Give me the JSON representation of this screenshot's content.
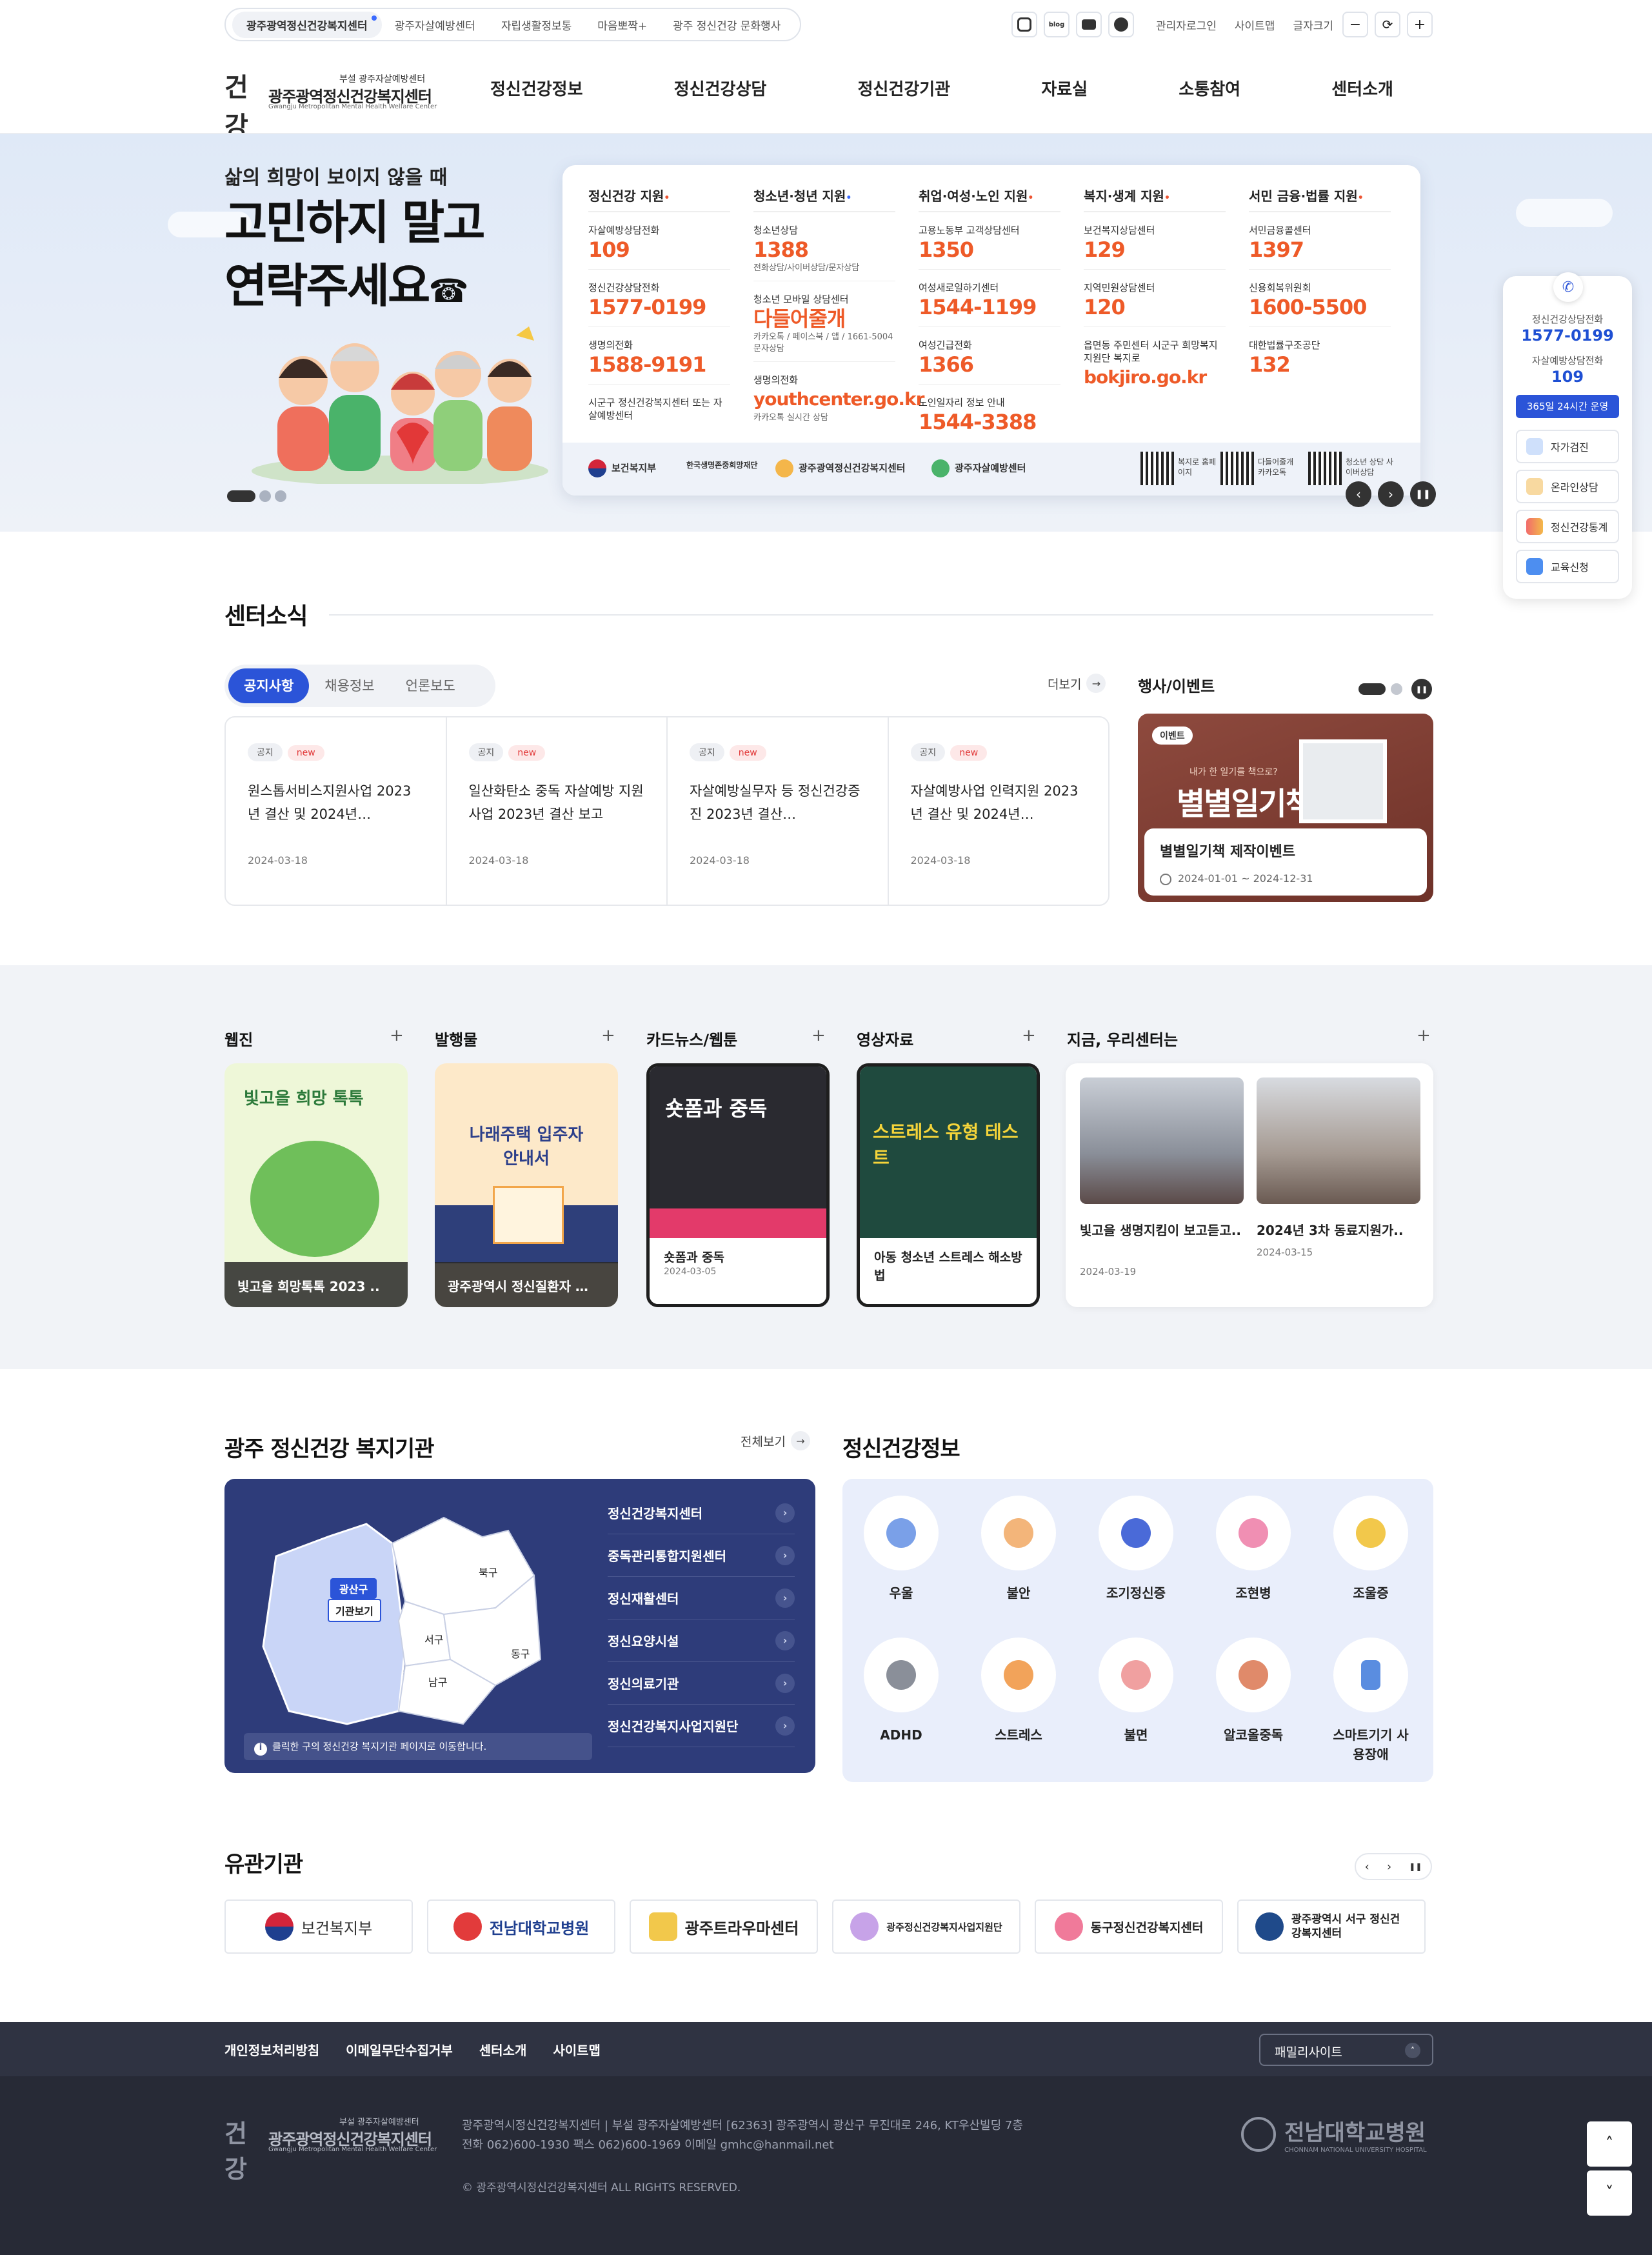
{
  "util": {
    "site_tabs": [
      "광주광역정신건강복지센터",
      "광주자살예방센터",
      "자립생활정보통",
      "마음뽀짝+",
      "광주 정신건강 문화행사"
    ],
    "sns": [
      "instagram-icon",
      "blog-icon",
      "youtube-icon",
      "talk-icon"
    ],
    "sns_blog": "blog",
    "links": [
      "관리자로그인",
      "사이트맵",
      "글자크기"
    ]
  },
  "logo": {
    "mark": "건강",
    "sub": "부설 광주자살예방센터",
    "main": "광주광역정신건강복지센터",
    "en": "Gwangju Metropolitan Mental Health Welfare Center"
  },
  "gnb": [
    "정신건강정보",
    "정신건강상담",
    "정신건강기관",
    "자료실",
    "소통참여",
    "센터소개"
  ],
  "hero": {
    "line1": "삶의 희망이 보이지 않을 때",
    "line2": "고민하지 말고",
    "line3": "연락주세요"
  },
  "hotline": {
    "cols": [
      {
        "title": "정신건강 지원",
        "items": [
          {
            "name": "자살예방상담전화",
            "num": "109",
            "note": ""
          },
          {
            "name": "정신건강상담전화",
            "num": "1577-0199",
            "note": ""
          },
          {
            "name": "생명의전화",
            "num": "1588-9191",
            "note": ""
          },
          {
            "name": "시군구 정신건강복지센터 또는 자살예방센터",
            "num": "",
            "note": ""
          }
        ]
      },
      {
        "title": "청소년·청년 지원",
        "items": [
          {
            "name": "청소년상담",
            "num": "1388",
            "note": "전화상담/사이버상담/문자상담"
          },
          {
            "name": "청소년 모바일 상담센터",
            "num": "다들어줄개",
            "note": "카카오톡 / 페이스북 / 앱 / 1661-5004 문자상담"
          },
          {
            "name": "생명의전화",
            "num": "youthcenter.go.kr",
            "note": "카카오톡 실시간 상담"
          }
        ]
      },
      {
        "title": "취업·여성·노인 지원",
        "items": [
          {
            "name": "고용노동부 고객상담센터",
            "num": "1350",
            "note": ""
          },
          {
            "name": "여성새로일하기센터",
            "num": "1544-1199",
            "note": ""
          },
          {
            "name": "여성긴급전화",
            "num": "1366",
            "note": ""
          },
          {
            "name": "노인일자리 정보 안내",
            "num": "1544-3388",
            "note": ""
          }
        ]
      },
      {
        "title": "복지·생계 지원",
        "items": [
          {
            "name": "보건복지상담센터",
            "num": "129",
            "note": ""
          },
          {
            "name": "지역민원상담센터",
            "num": "120",
            "note": ""
          },
          {
            "name": "읍면동 주민센터 시군구 희망복지지원단 복지로",
            "num": "bokjiro.go.kr",
            "note": ""
          }
        ]
      },
      {
        "title": "서민 금융·법률 지원",
        "items": [
          {
            "name": "서민금융콜센터",
            "num": "1397",
            "note": ""
          },
          {
            "name": "신용회복위원회",
            "num": "1600-5500",
            "note": ""
          },
          {
            "name": "대한법률구조공단",
            "num": "132",
            "note": ""
          }
        ]
      }
    ],
    "orgs": [
      "보건복지부",
      "한국생명존중희망재단",
      "광주광역정신건강복지센터",
      "광주자살예방센터"
    ],
    "qrs": [
      "복지로 홈페이지",
      "다들어줄개 카카오톡",
      "청소년 상담 사이버상담"
    ]
  },
  "quick": {
    "l1": "정신건강상담전화",
    "n1": "1577-0199",
    "l2": "자살예방상담전화",
    "n2": "109",
    "op": "365일 24시간 운영",
    "menu": [
      "자가검진",
      "온라인상담",
      "정신건강통계",
      "교육신청"
    ]
  },
  "news": {
    "title": "센터소식",
    "tabs": [
      "공지사항",
      "채용정보",
      "언론보도"
    ],
    "more": "더보기",
    "items": [
      {
        "tag": "공지",
        "new": "new",
        "title": "원스톱서비스지원사업 2023년 결산 및 2024년…",
        "date": "2024-03-18"
      },
      {
        "tag": "공지",
        "new": "new",
        "title": "일산화탄소 중독 자살예방 지원사업 2023년 결산 보고",
        "date": "2024-03-18"
      },
      {
        "tag": "공지",
        "new": "new",
        "title": "자살예방실무자 등 정신건강증진 2023년 결산…",
        "date": "2024-03-18"
      },
      {
        "tag": "공지",
        "new": "new",
        "title": "자살예방사업 인력지원 2023년 결산 및 2024년…",
        "date": "2024-03-18"
      }
    ],
    "event_head": "행사/이벤트",
    "event": {
      "badge": "이벤트",
      "small": "내가 한 일기를 책으로?",
      "big": "별별일기책",
      "title": "별별일기책 제작이벤트",
      "date": "2024-01-01 ~ 2024-12-31"
    }
  },
  "media": {
    "webzine": {
      "head": "웹진",
      "cover": "빛고을 희망 톡톡",
      "caption": "빛고을 희망톡톡 2023 .."
    },
    "pub": {
      "head": "발행물",
      "cover": "나래주택 입주자 안내서",
      "caption": "광주광역시 정신질환자 …"
    },
    "card": {
      "head": "카드뉴스/웹툰",
      "cover": "숏폼과 중독",
      "title": "숏폼과 중독",
      "date": "2024-03-05"
    },
    "video": {
      "head": "영상자료",
      "cover": "스트레스 유형 테스트",
      "title": "아동 청소년 스트레스 해소방법"
    },
    "now": {
      "head": "지금, 우리센터는",
      "items": [
        {
          "title": "빛고을 생명지킴이 보고듣고..",
          "date": "2024-03-19"
        },
        {
          "title": "2024년 3차 동료지원가..",
          "date": "2024-03-15"
        }
      ]
    }
  },
  "facility": {
    "title": "광주 정신건강 복지기관",
    "more": "전체보기",
    "districts": [
      "광산구",
      "북구",
      "서구",
      "동구",
      "남구"
    ],
    "view": "기관보기",
    "list": [
      "정신건강복지센터",
      "중독관리통합지원센터",
      "정신재활센터",
      "정신요양시설",
      "정신의료기관",
      "정신건강복지사업지원단"
    ],
    "note": "클릭한 구의 정신건강 복지기관 페이지로 이동합니다."
  },
  "health": {
    "title": "정신건강정보",
    "items": [
      "우울",
      "불안",
      "조기정신증",
      "조현병",
      "조울증",
      "ADHD",
      "스트레스",
      "불면",
      "알코올중독",
      "스마트기기 사용장애"
    ],
    "colors": [
      "#7aa0e8",
      "#f3b57a",
      "#4a6ad8",
      "#f08fb3",
      "#f2c84b",
      "#8a8f99",
      "#f2a35a",
      "#f0a0a0",
      "#e08a6a",
      "#5a8de0"
    ]
  },
  "related": {
    "title": "유관기관",
    "items": [
      "보건복지부",
      "전남대학교병원",
      "광주트라우마센터",
      "광주정신건강복지사업지원단",
      "동구정신건강복지센터",
      "광주광역시 서구 정신건강복지센터"
    ]
  },
  "footer": {
    "links": [
      "개인정보처리방침",
      "이메일무단수집거부",
      "센터소개",
      "사이트맵"
    ],
    "family": "패밀리사이트",
    "addr1": "광주광역시정신건강복지센터 | 부설 광주자살예방센터 [62363] 광주광역시 광산구 무진대로 246, KT우산빌딩 7층",
    "addr2": "전화 062)600-1930 팩스 062)600-1969 이메일 gmhc@hanmail.net",
    "copy": "© 광주광역시정신건강복지센터 ALL RIGHTS RESERVED.",
    "hospital": "전남대학교병원",
    "hospital_en": "CHONNAM NATIONAL UNIVERSITY HOSPITAL"
  }
}
